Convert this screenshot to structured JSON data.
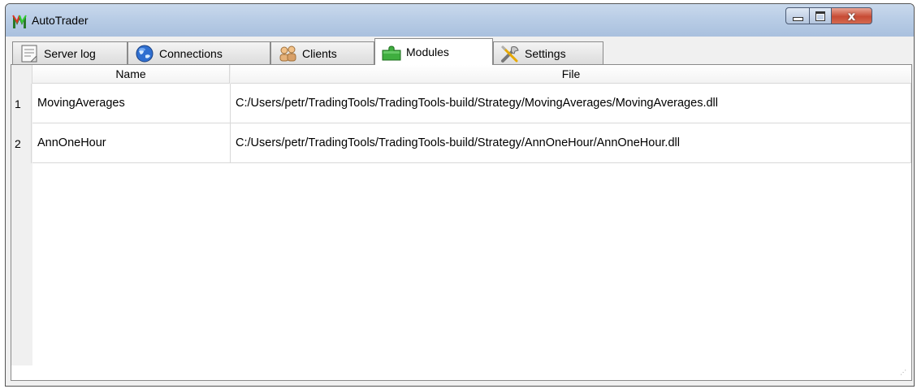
{
  "window": {
    "title": "AutoTrader",
    "controls": {
      "minimize": "minimize",
      "maximize": "maximize",
      "close": "x"
    }
  },
  "tabs": [
    {
      "label": "Server log",
      "icon": "server-log-icon",
      "active": false
    },
    {
      "label": "Connections",
      "icon": "globe-icon",
      "active": false
    },
    {
      "label": "Clients",
      "icon": "users-icon",
      "active": false
    },
    {
      "label": "Modules",
      "icon": "puzzle-icon",
      "active": true
    },
    {
      "label": "Settings",
      "icon": "tools-icon",
      "active": false
    }
  ],
  "table": {
    "columns": [
      "Name",
      "File"
    ],
    "rows": [
      {
        "index": "1",
        "name": "MovingAverages",
        "file": "C:/Users/petr/TradingTools/TradingTools-build/Strategy/MovingAverages/MovingAverages.dll"
      },
      {
        "index": "2",
        "name": "AnnOneHour",
        "file": "C:/Users/petr/TradingTools/TradingTools-build/Strategy/AnnOneHour/AnnOneHour.dll"
      }
    ]
  },
  "colors": {
    "titlebar": "#b9cde6",
    "close_button": "#c74b34",
    "tab_active_bg": "#ffffff",
    "modules_icon": "#3fae3f"
  }
}
